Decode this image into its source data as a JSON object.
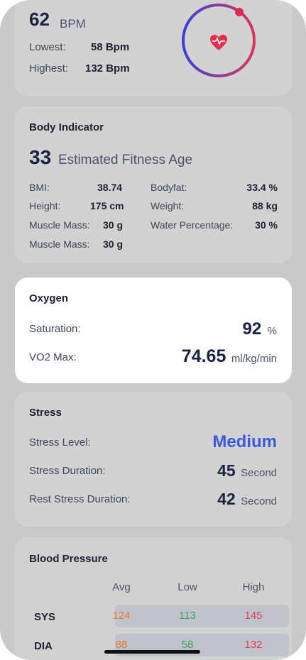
{
  "heart": {
    "bpm_value": "62",
    "bpm_unit": "BPM",
    "lowest_label": "Lowest:",
    "lowest_value": "58 Bpm",
    "highest_label": "Highest:",
    "highest_value": "132 Bpm",
    "icon": "heart-pulse-icon"
  },
  "body": {
    "title": "Body Indicator",
    "age_value": "33",
    "age_label": "Estimated Fitness Age",
    "bmi_label": "BMI:",
    "bmi_value": "38.74",
    "height_label": "Height:",
    "height_value": "175 cm",
    "muscle1_label": "Muscle Mass:",
    "muscle1_value": "30 g",
    "muscle2_label": "Muscle Mass:",
    "muscle2_value": "30 g",
    "bodyfat_label": "Bodyfat:",
    "bodyfat_value": "33.4 %",
    "weight_label": "Weight:",
    "weight_value": "88 kg",
    "water_label": "Water Percentage:",
    "water_value": "30 %"
  },
  "oxygen": {
    "title": "Oxygen",
    "saturation_label": "Saturation:",
    "saturation_value": "92",
    "saturation_unit": "%",
    "vo2_label": "VO2 Max:",
    "vo2_value": "74.65",
    "vo2_unit": "ml/kg/min"
  },
  "stress": {
    "title": "Stress",
    "level_label": "Stress Level:",
    "level_value": "Medium",
    "duration_label": "Stress Duration:",
    "duration_value": "45",
    "duration_unit": "Second",
    "rest_label": "Rest Stress Duration:",
    "rest_value": "42",
    "rest_unit": "Second"
  },
  "bp": {
    "title": "Blood Pressure",
    "col_avg": "Avg",
    "col_low": "Low",
    "col_high": "High",
    "sys_label": "SYS",
    "sys_avg": "124",
    "sys_low": "113",
    "sys_high": "145",
    "dia_label": "DIA",
    "dia_avg": "88",
    "dia_low": "58",
    "dia_high": "132"
  },
  "colors": {
    "accent_blue": "#3b5bdb",
    "avg": "#e07a2e",
    "low": "#3aa05a",
    "high": "#d8415c"
  }
}
